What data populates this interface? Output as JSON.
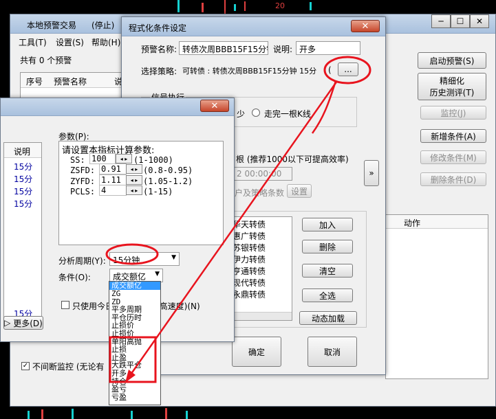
{
  "bg_window": {
    "title": "本地预警交易",
    "status": "(停止)",
    "menu": [
      "工具(T)",
      "设置(S)",
      "帮助(H)"
    ],
    "count": "共有 0 个预警",
    "cols": [
      "序号",
      "预警名称",
      "说"
    ],
    "continuous": "不间断监控 (无论有",
    "more": "更多(D)",
    "top_right_num": "20"
  },
  "right_panel": {
    "start": "启动预警(S)",
    "detail": "精细化",
    "backtest": "历史测评(T)",
    "monitor": "监控(J)",
    "add_cond": "新增条件(A)",
    "edit_cond": "修改条件(M)",
    "del_cond": "删除条件(D)",
    "action_col": "动作"
  },
  "main_dialog": {
    "title": "程式化条件设定",
    "alert_name_label": "预警名称:",
    "alert_name_value": "转债次周BBB15F15分钟",
    "desc_label": "说明:",
    "desc_value": "开多",
    "strategy_label": "选择策略:",
    "strategy_value": "可转债 : 转债次周BBB15F15分钟 15分",
    "strategy_tail": "(",
    "browse": "...",
    "signal_group": "信号执行",
    "signal_opt": "少",
    "finish_bar": "走完一根K线",
    "root_hint": "根 (推荐1000以下可提高效率)",
    "time_value": "2 00:00:00",
    "params_hint": "户及策略条数",
    "setting_btn": "设置",
    "expand": "»",
    "stocks": [
      "华天转债",
      "惠广转债",
      "苏银转债",
      "伊力转债",
      "亨通转债",
      "现代转债",
      "永鼎转债"
    ],
    "add": "加入",
    "delete": "删除",
    "clear": "清空",
    "select_all": "全选",
    "dynamic_load": "动态加载",
    "ok": "确定",
    "cancel": "取消"
  },
  "indicator_dialog": {
    "params_label": "参数(P):",
    "params_hint": "请设置本指标计算参数:",
    "params": [
      {
        "name": "SS:",
        "value": "100",
        "range": "(1-1000)"
      },
      {
        "name": "ZSFD:",
        "value": "0.91",
        "range": "(0.8-0.95)"
      },
      {
        "name": "ZYFD:",
        "value": "1.11",
        "range": "(1.05-1.2)"
      },
      {
        "name": "PCLS:",
        "value": "4",
        "range": "(1-15)"
      }
    ],
    "left_header": "说明",
    "left_items": [
      "15分",
      "15分",
      "15分",
      "15分",
      "15分"
    ],
    "period_label": "分析周期(Y):",
    "period_value": "15分钟",
    "cond_label": "条件(O):",
    "cond_value": "成交额亿",
    "cond_options": [
      "成交额亿",
      "ZG",
      "ZD",
      "平多周期",
      "平仓历时",
      "止损价",
      "止损价",
      "单阳高抛",
      "止损",
      "止盈",
      "大跌平仓",
      "开多",
      "持仓",
      "盈亏",
      "亏盈"
    ],
    "use_today": "只使用今日",
    "speed_hint": "日(提高速度)(N)"
  }
}
